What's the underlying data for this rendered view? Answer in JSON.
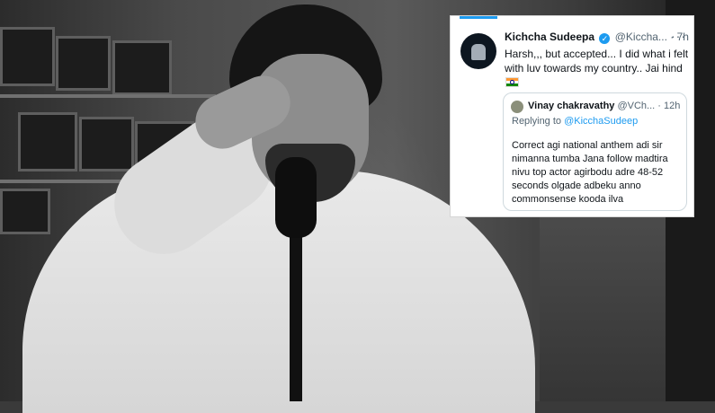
{
  "tweet": {
    "author_name": "Kichcha Sudeepa",
    "handle": "@Kiccha...",
    "separator": "·",
    "time": "7h",
    "more_icon": "more-horizontal-icon",
    "text": "Harsh,,, but accepted... I did what i felt with luv towards my country.. Jai hind",
    "emoji": "india-flag-icon",
    "quoted": {
      "author_name": "Vinay chakravathy",
      "handle": "@VCh...",
      "separator": "·",
      "time": "12h",
      "replying_prefix": "Replying to",
      "replying_to": "@KicchaSudeep",
      "text": "Correct agi national anthem adi sir nimanna tumba Jana  follow madtira nivu top actor agirbodu adre 48-52 seconds olgade adbeku anno commonsense kooda ilva"
    }
  },
  "colors": {
    "accent": "#1d9bf0",
    "text_primary": "#0f1419",
    "text_secondary": "#536471"
  }
}
